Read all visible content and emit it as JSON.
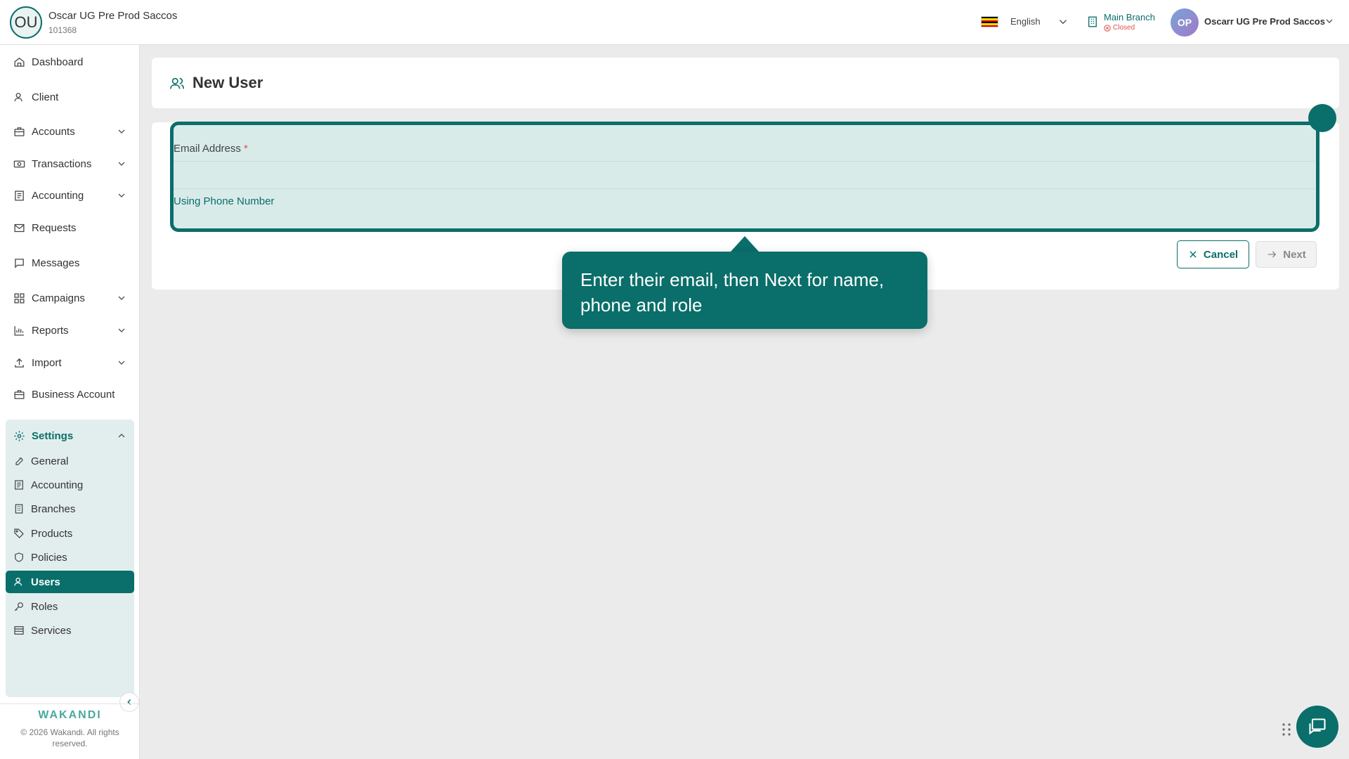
{
  "header": {
    "org_initials": "OU",
    "org_name": "Oscar UG Pre Prod Saccos",
    "org_id": "101368",
    "language": "English",
    "branch_name": "Main Branch",
    "branch_status": "Closed",
    "user_initials": "OP",
    "user_name": "Oscarr UG Pre Prod Saccos"
  },
  "sidebar": {
    "items": [
      {
        "label": "Dashboard",
        "icon": "home-icon"
      },
      {
        "label": "Client",
        "icon": "user-icon"
      },
      {
        "label": "Accounts",
        "icon": "briefcase-icon"
      },
      {
        "label": "Transactions",
        "icon": "money-icon"
      },
      {
        "label": "Accounting",
        "icon": "ledger-icon"
      },
      {
        "label": "Requests",
        "icon": "mail-icon"
      },
      {
        "label": "Messages",
        "icon": "message-icon"
      },
      {
        "label": "Campaigns",
        "icon": "grid-icon"
      },
      {
        "label": "Reports",
        "icon": "chart-icon"
      },
      {
        "label": "Import",
        "icon": "upload-icon"
      },
      {
        "label": "Business Account",
        "icon": "briefcase-icon"
      }
    ],
    "settings": {
      "label": "Settings",
      "items": [
        {
          "label": "General"
        },
        {
          "label": "Accounting"
        },
        {
          "label": "Branches"
        },
        {
          "label": "Products"
        },
        {
          "label": "Policies"
        },
        {
          "label": "Users"
        },
        {
          "label": "Roles"
        },
        {
          "label": "Services"
        }
      ]
    },
    "logo": "WAKANDI",
    "copyright": "© 2026 Wakandi. All rights reserved."
  },
  "main": {
    "title": "New User",
    "email_label": "Email Address",
    "required_mark": "*",
    "email_value": "",
    "phone_link": "Using Phone Number",
    "cancel_label": "Cancel",
    "next_label": "Next"
  },
  "tooltip": {
    "text": "Enter their email, then Next for name, phone and role"
  },
  "colors": {
    "accent": "#0a6e6a",
    "highlight_bg": "#d9ebe9",
    "danger": "#d9534f"
  }
}
